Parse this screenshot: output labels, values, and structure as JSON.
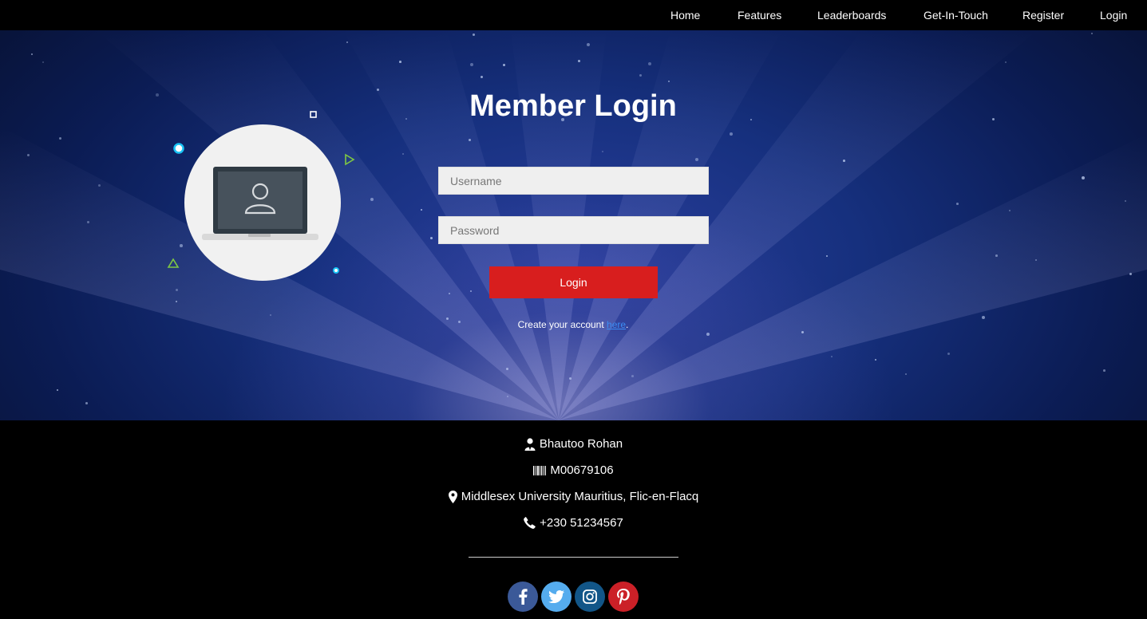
{
  "nav": {
    "items": [
      {
        "label": "Home"
      },
      {
        "label": "Features"
      },
      {
        "label": "Leaderboards"
      },
      {
        "label": "Get-In-Touch"
      },
      {
        "label": "Register"
      },
      {
        "label": "Login"
      }
    ]
  },
  "login": {
    "title": "Member Login",
    "username_placeholder": "Username",
    "password_placeholder": "Password",
    "button_label": "Login",
    "create_text": "Create your account ",
    "create_link": "here",
    "create_suffix": "."
  },
  "footer": {
    "name": "Bhautoo Rohan",
    "id": "M00679106",
    "address": "Middlesex University Mauritius, Flic-en-Flacq",
    "phone": "+230 51234567",
    "icons": {
      "name": "user-tie-icon",
      "id": "barcode-icon",
      "address": "map-marker-icon",
      "phone": "phone-icon"
    }
  },
  "social": [
    {
      "name": "facebook",
      "color": "#3b5998"
    },
    {
      "name": "twitter",
      "color": "#55acee"
    },
    {
      "name": "instagram",
      "color": "#125688"
    },
    {
      "name": "pinterest",
      "color": "#cb2027"
    }
  ],
  "colors": {
    "login_button": "#d81e1e",
    "link": "#3b8df5",
    "decor_cyan": "#19c3f5",
    "decor_green": "#7ec843"
  }
}
